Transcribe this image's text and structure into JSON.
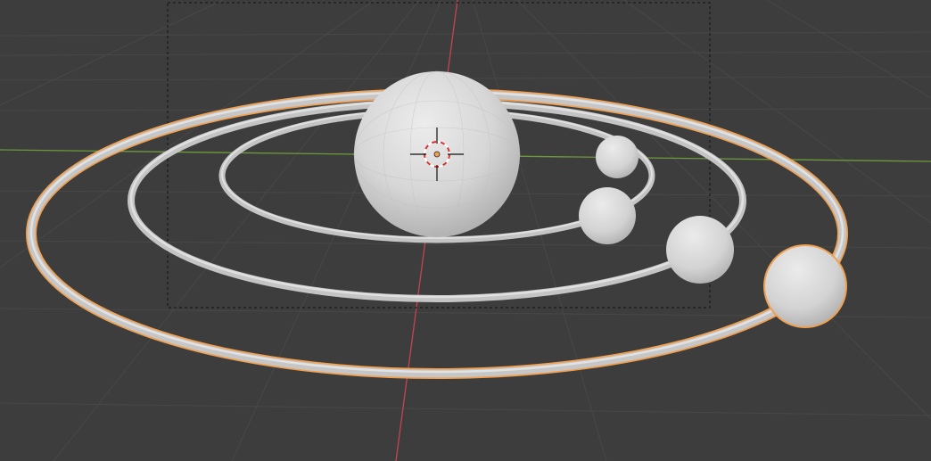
{
  "viewport": {
    "mode": "3D Viewport",
    "background_color": "#3d3d3d",
    "grid_color": "#494949",
    "x_axis_color": "#c4454f",
    "y_axis_color": "#6c9a3a",
    "selection_outline_color": "#f0a050"
  },
  "scene": {
    "objects": [
      {
        "name": "sun-sphere",
        "selected": false
      },
      {
        "name": "planet-1",
        "selected": false
      },
      {
        "name": "planet-2",
        "selected": false
      },
      {
        "name": "planet-3",
        "selected": false
      },
      {
        "name": "planet-4",
        "selected": true
      },
      {
        "name": "orbit-ring-1",
        "selected": false
      },
      {
        "name": "orbit-ring-2",
        "selected": false
      },
      {
        "name": "orbit-ring-3",
        "selected": true
      }
    ]
  },
  "overlays": {
    "camera_frame": "dashed",
    "cursor_icon": "3d-cursor-icon"
  }
}
